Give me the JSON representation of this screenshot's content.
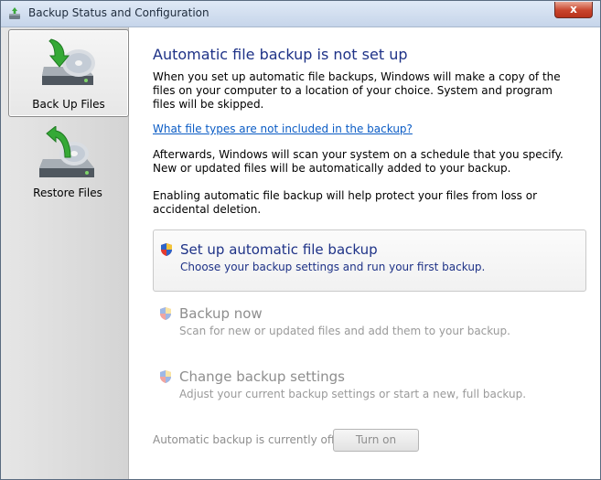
{
  "window": {
    "title": "Backup Status and Configuration",
    "close_label": "x"
  },
  "sidebar": {
    "items": [
      {
        "label": "Back Up Files",
        "icon": "backup-disk-icon",
        "selected": true
      },
      {
        "label": "Restore Files",
        "icon": "restore-disk-icon",
        "selected": false
      }
    ]
  },
  "main": {
    "heading": "Automatic file backup is not set up",
    "intro": "When you set up automatic file backups, Windows will make a copy of the files on your computer to a location of your choice. System and program files will be skipped.",
    "link": "What file types are not included in the backup?",
    "afterwards": "Afterwards, Windows will scan your system on a schedule that you specify. New or updated files will be automatically added to your backup.",
    "enabling": "Enabling automatic file backup will help protect your files from loss or accidental deletion.",
    "tasks": [
      {
        "title": "Set up automatic file backup",
        "desc": "Choose your backup settings and run your first backup.",
        "icon": "uac-shield-icon",
        "enabled": true
      },
      {
        "title": "Backup now",
        "desc": "Scan for new or updated files and add them to your backup.",
        "icon": "uac-shield-icon",
        "enabled": false
      },
      {
        "title": "Change backup settings",
        "desc": "Adjust your current backup settings or start a new, full backup.",
        "icon": "uac-shield-icon",
        "enabled": false
      }
    ],
    "status": "Automatic backup is currently off",
    "turn_on_label": "Turn on"
  },
  "colors": {
    "heading": "#1e3287",
    "link": "#0b5cc5",
    "disabled_text": "#8e8e8e"
  }
}
